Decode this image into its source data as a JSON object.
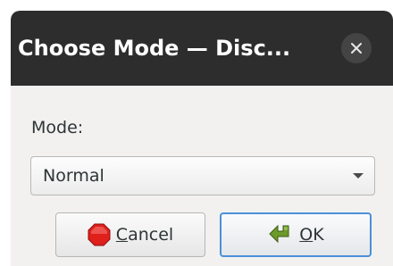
{
  "window": {
    "title": "Choose Mode — Disc...",
    "close_icon": "close-icon"
  },
  "form": {
    "mode_label": "Mode:",
    "mode_selected": "Normal"
  },
  "buttons": {
    "cancel": {
      "mnemonic": "C",
      "rest": "ancel",
      "icon": "stop-sign-icon"
    },
    "ok": {
      "mnemonic": "O",
      "rest": "K",
      "icon": "ok-arrow-icon"
    }
  },
  "colors": {
    "titlebar": "#2d2d2d",
    "dialog_bg": "#f2f1f0",
    "focus_border": "#4a90d9",
    "stop_red": "#e0201b",
    "ok_green": "#6c9a2b"
  }
}
